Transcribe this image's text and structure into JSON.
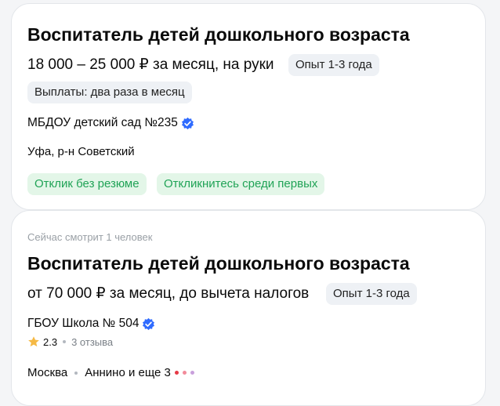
{
  "vacancies": [
    {
      "title": "Воспитатель детей дошкольного возраста",
      "salary": "18 000 – 25 000 ₽ за месяц, на руки",
      "experience": "Опыт 1-3 года",
      "payout": "Выплаты: два раза в месяц",
      "company": "МБДОУ детский сад №235",
      "location": "Уфа, р-н Советский",
      "tags": [
        "Отклик без резюме",
        "Откликнитесь среди первых"
      ]
    },
    {
      "viewing": "Сейчас смотрит 1 человек",
      "title": "Воспитатель детей дошкольного возраста",
      "salary": "от 70 000 ₽ за месяц, до вычета налогов",
      "experience": "Опыт 1-3 года",
      "company": "ГБОУ Школа № 504",
      "rating": "2.3",
      "reviews": "3 отзыва",
      "city": "Москва",
      "metro": "Аннино и еще 3"
    }
  ],
  "colors": {
    "verified": "#2f6bff",
    "green_chip_text": "#20a356",
    "green_chip_bg": "#e3f6e8",
    "star": "#f5b945",
    "metro_dots": [
      "#e63946",
      "#f28b9a",
      "#c9a0dc"
    ]
  }
}
